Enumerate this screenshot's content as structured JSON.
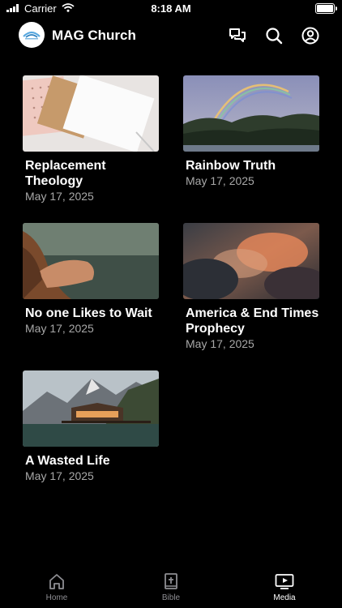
{
  "status": {
    "carrier": "Carrier",
    "time": "8:18 AM"
  },
  "header": {
    "title": "MAG Church"
  },
  "media": [
    {
      "title": "Replacement Theology",
      "date": "May 17, 2025"
    },
    {
      "title": "Rainbow Truth",
      "date": "May 17, 2025"
    },
    {
      "title": "No one Likes to Wait",
      "date": "May 17, 2025"
    },
    {
      "title": "America & End Times Prophecy",
      "date": "May 17, 2025"
    },
    {
      "title": "A Wasted Life",
      "date": "May 17, 2025"
    }
  ],
  "tabs": [
    {
      "label": "Home",
      "icon": "home-icon"
    },
    {
      "label": "Bible",
      "icon": "bible-icon"
    },
    {
      "label": "Media",
      "icon": "media-icon",
      "active": true
    }
  ],
  "colors": {
    "background": "#000000",
    "text": "#ffffff",
    "muted": "#a8a8a8",
    "tab_inactive": "#8e8e93"
  }
}
